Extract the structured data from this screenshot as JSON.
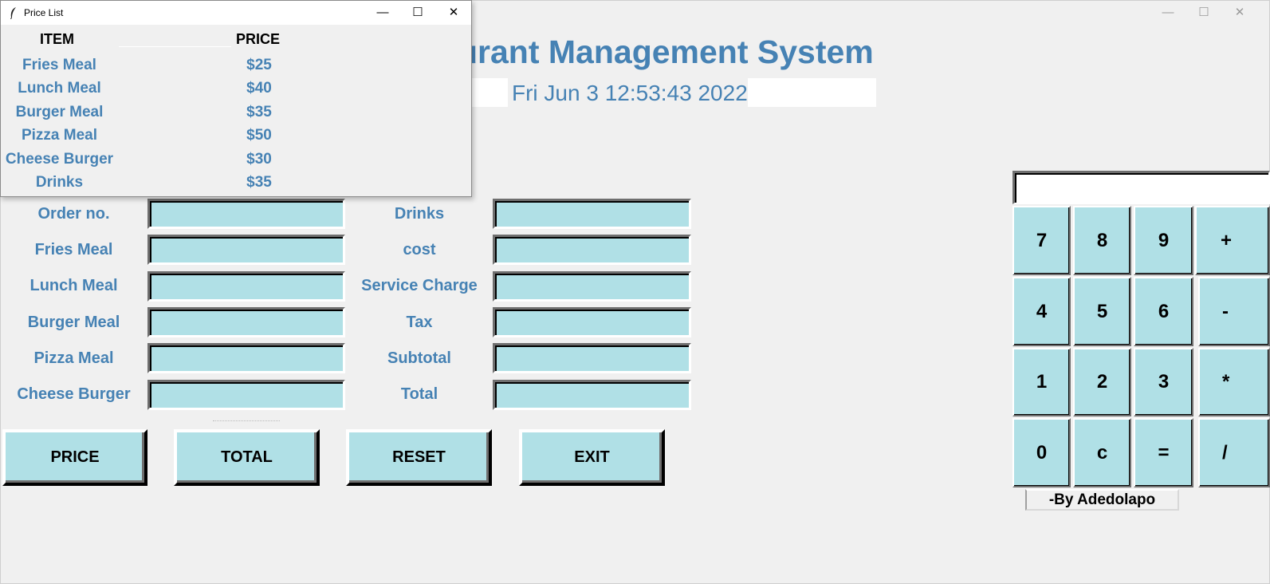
{
  "main_window": {
    "title_visible": "urant Management System",
    "clock": "Fri Jun  3 12:53:43 2022",
    "controls": {
      "minimize": "—",
      "maximize": "☐",
      "close": "✕"
    }
  },
  "order_form": {
    "left_labels": [
      "Order no.",
      "Fries Meal",
      "Lunch Meal",
      "Burger Meal",
      "Pizza Meal",
      "Cheese Burger"
    ],
    "right_labels": [
      "Drinks",
      "cost",
      "Service Charge",
      "Tax",
      "Subtotal",
      "Total"
    ]
  },
  "buttons": {
    "price": "PRICE",
    "total": "TOTAL",
    "reset": "RESET",
    "exit": "EXIT"
  },
  "calculator": {
    "display_value": "",
    "keys": [
      "7",
      "8",
      "9",
      "+",
      "4",
      "5",
      "6",
      "-",
      "1",
      "2",
      "3",
      "*",
      "0",
      "c",
      "=",
      "/"
    ],
    "credit": "-By Adedolapo"
  },
  "price_list": {
    "window_title": "Price List",
    "header_item": "ITEM",
    "header_price": "PRICE",
    "rows": [
      {
        "item": "Fries Meal",
        "price": "$25"
      },
      {
        "item": "Lunch Meal",
        "price": "$40"
      },
      {
        "item": "Burger Meal",
        "price": "$35"
      },
      {
        "item": "Pizza Meal",
        "price": "$50"
      },
      {
        "item": "Cheese Burger",
        "price": "$30"
      },
      {
        "item": "Drinks",
        "price": "$35"
      }
    ],
    "controls": {
      "minimize": "—",
      "maximize": "☐",
      "close": "✕"
    }
  },
  "colors": {
    "accent": "#4682b4",
    "entry_bg": "#b0e0e6",
    "window_bg": "#f0f0f0"
  }
}
